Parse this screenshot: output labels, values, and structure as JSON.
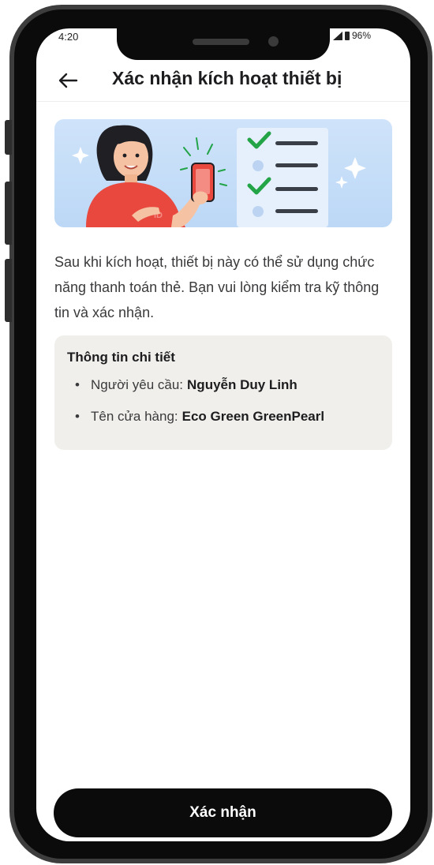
{
  "status_bar": {
    "time": "4:20",
    "battery": "96%"
  },
  "header": {
    "back_icon": "arrow-left-icon",
    "title": "Xác nhận kích hoạt thiết bị"
  },
  "banner": {
    "illustration": "person-holding-phone-with-checklist",
    "shirt_text": "ID"
  },
  "description": "Sau khi kích hoạt, thiết bị này có thể sử dụng chức năng thanh toán thẻ. Bạn vui lòng kiểm tra kỹ thông tin và xác nhận.",
  "details": {
    "title": "Thông tin chi tiết",
    "items": [
      {
        "label": "Người yêu cầu:",
        "value": "Nguyễn Duy Linh"
      },
      {
        "label": "Tên cửa hàng:",
        "value": "Eco Green GreenPearl"
      }
    ]
  },
  "confirm_button": {
    "label": "Xác nhận"
  },
  "colors": {
    "primary": "#0b0b0b",
    "card_bg": "#f0efeb",
    "banner_bg": "#cfe3fa",
    "check_green": "#22a447",
    "shirt_red": "#e8483d"
  }
}
